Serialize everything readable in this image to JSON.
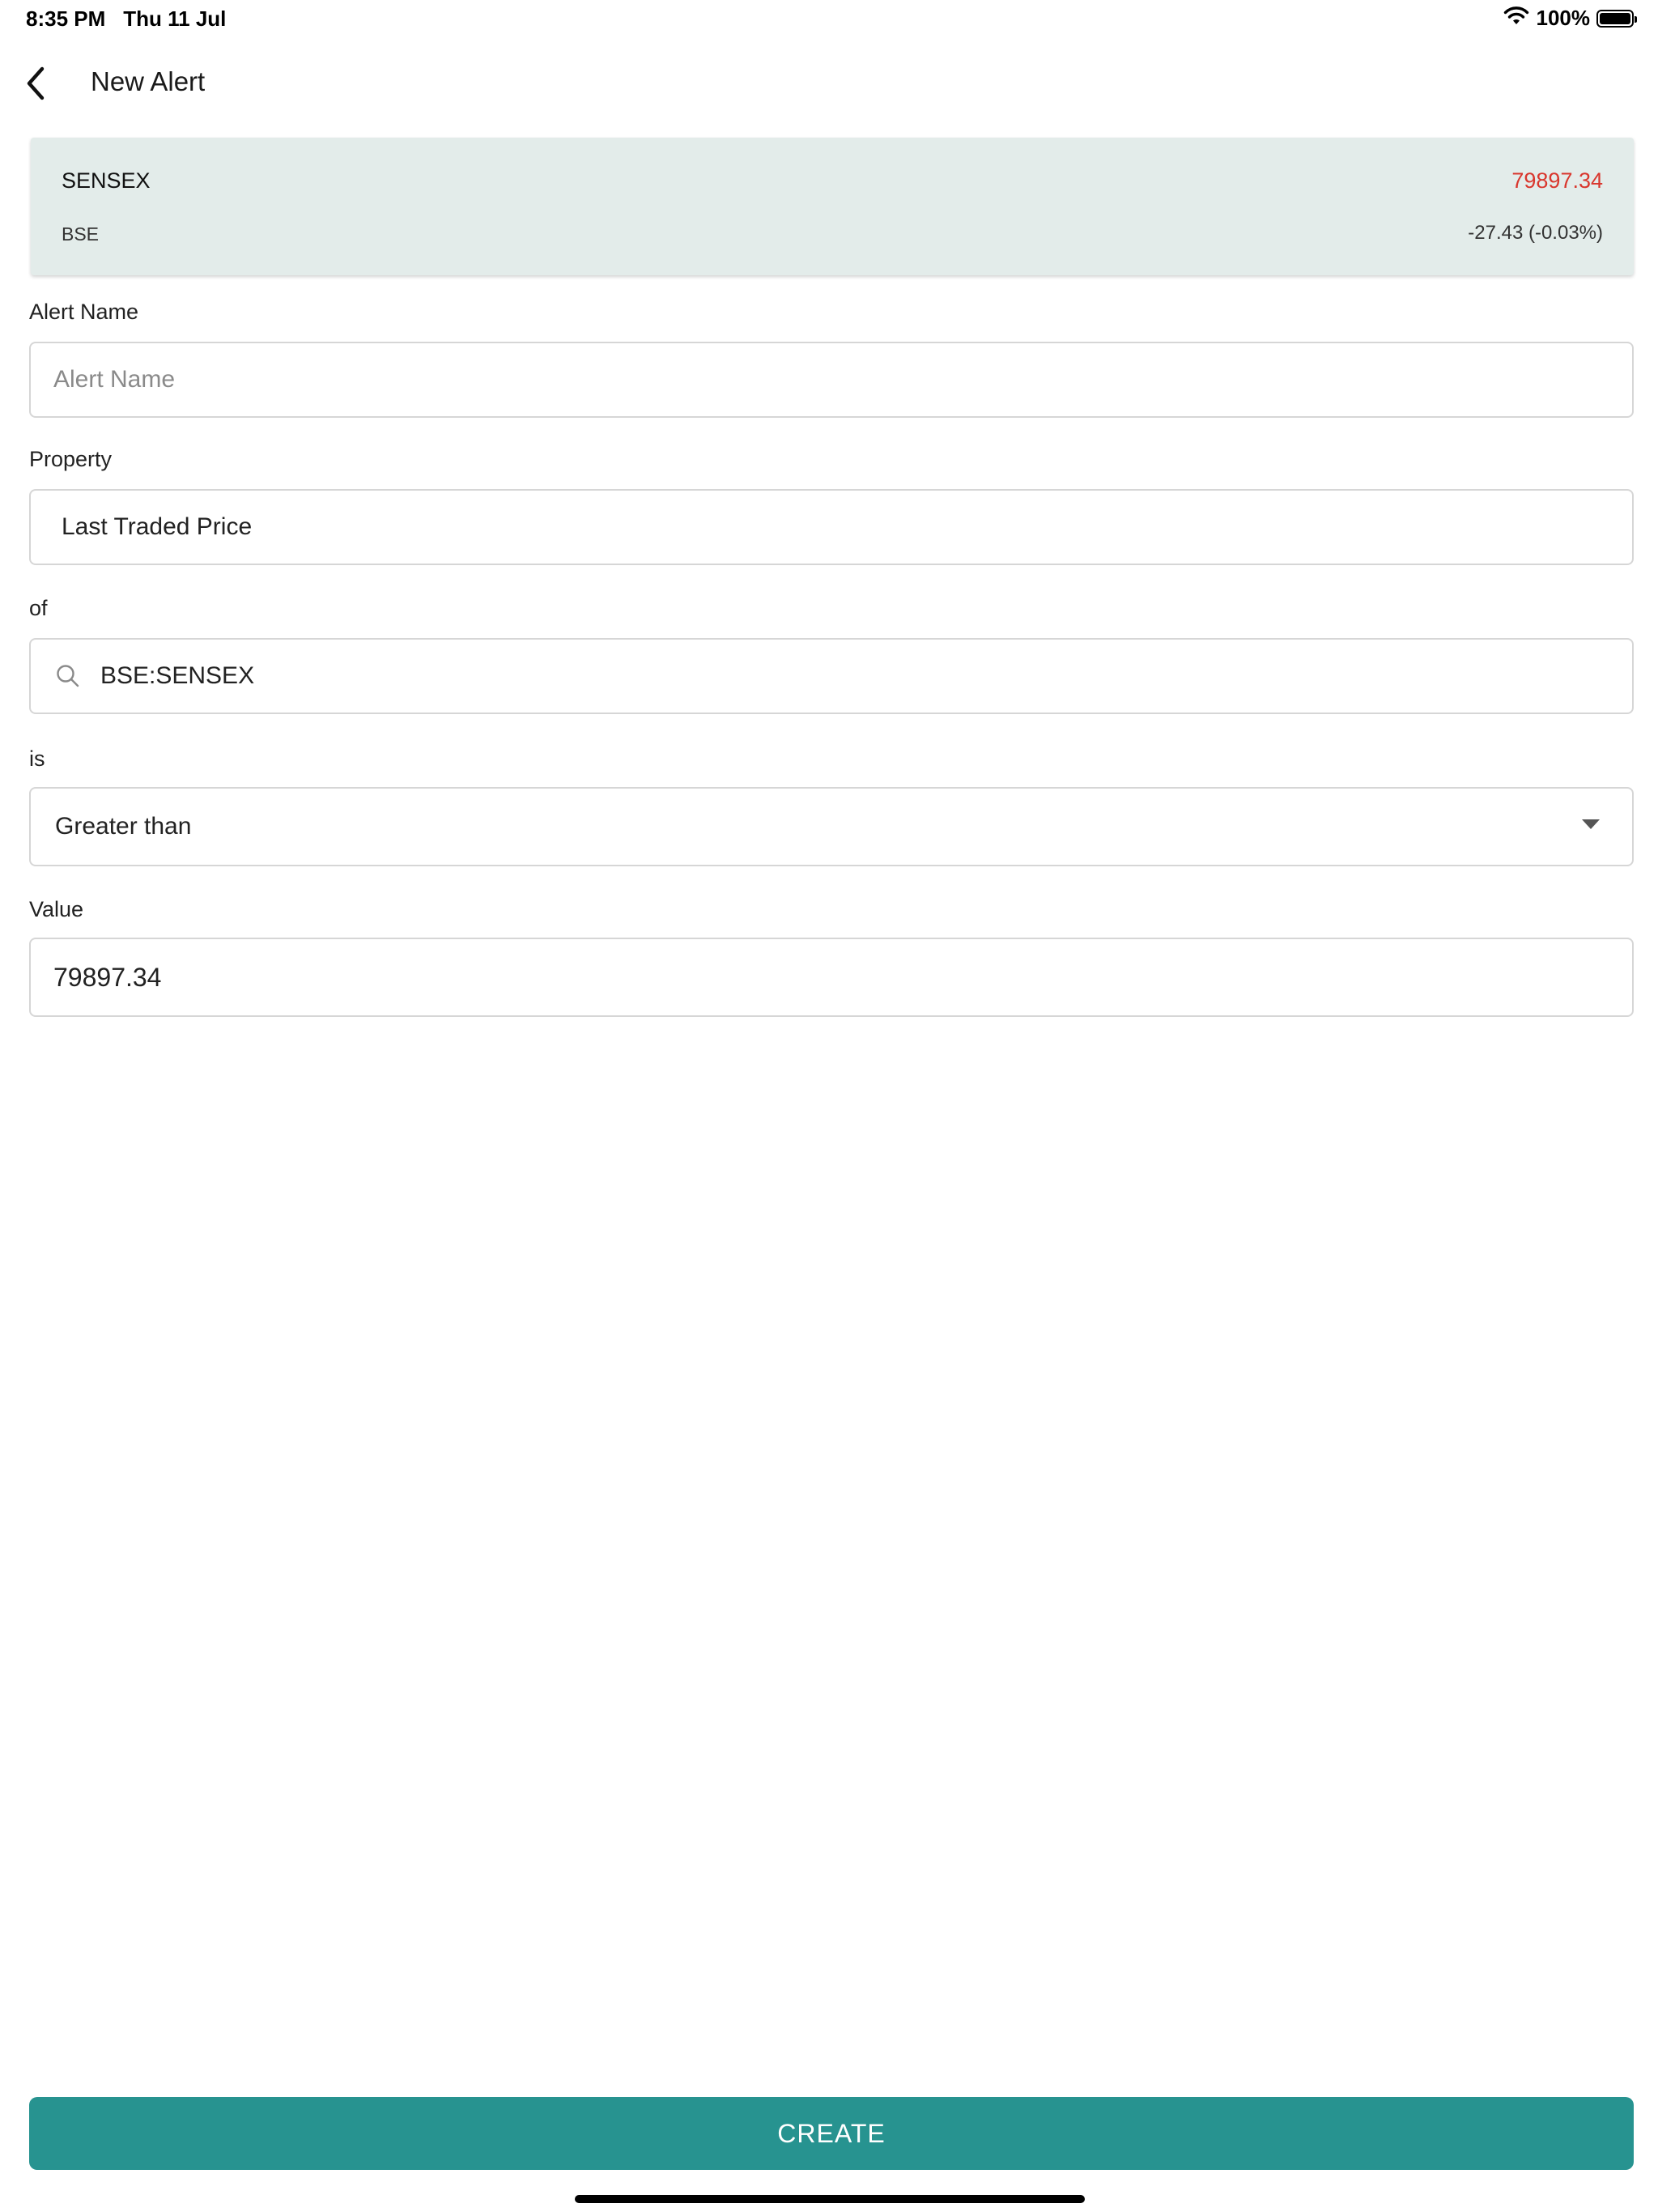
{
  "status_bar": {
    "time": "8:35 PM",
    "date": "Thu 11 Jul",
    "battery": "100%",
    "battery_level": 1.0
  },
  "header": {
    "title": "New Alert",
    "back_icon": "chevron-left-icon"
  },
  "quote": {
    "symbol": "SENSEX",
    "exchange": "BSE",
    "last_price": "79897.34",
    "change": "-27.43 (-0.03%)",
    "price_color": "#d9372e"
  },
  "form": {
    "alert_name": {
      "label": "Alert Name",
      "placeholder": "Alert Name",
      "value": ""
    },
    "property": {
      "label": "Property",
      "value": "Last Traded Price"
    },
    "of": {
      "label": "of",
      "value": "BSE:SENSEX",
      "icon": "search-icon"
    },
    "is": {
      "label": "is",
      "value": "Greater than",
      "icon": "dropdown-arrow-icon"
    },
    "value": {
      "label": "Value",
      "value": "79897.34"
    }
  },
  "actions": {
    "create_label": "CREATE",
    "accent_color": "#279390"
  }
}
